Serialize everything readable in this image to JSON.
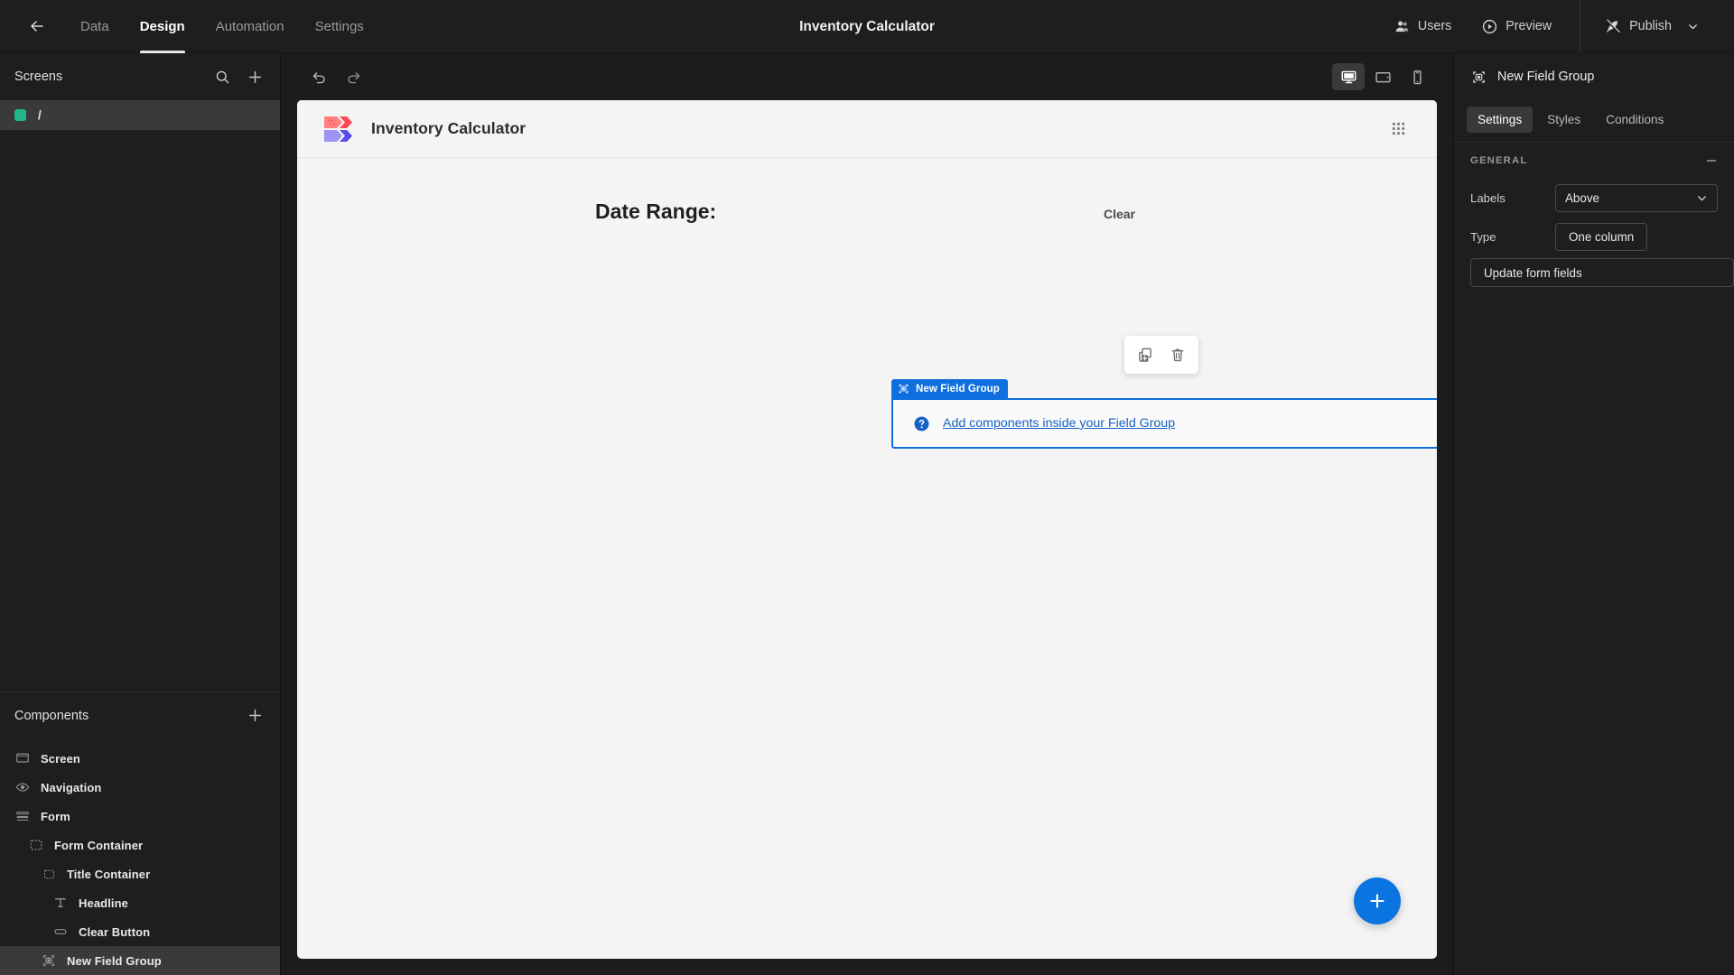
{
  "topbar": {
    "back_icon": "arrow-left-icon",
    "nav_tabs": [
      {
        "label": "Data",
        "active": false
      },
      {
        "label": "Design",
        "active": true
      },
      {
        "label": "Automation",
        "active": false
      },
      {
        "label": "Settings",
        "active": false
      }
    ],
    "title": "Inventory Calculator",
    "users_label": "Users",
    "preview_label": "Preview",
    "publish_label": "Publish"
  },
  "left_panel": {
    "screens": {
      "title": "Screens",
      "search_icon": "search-icon",
      "add_icon": "plus-icon",
      "items": [
        {
          "label": "/",
          "color": "#23b58a",
          "selected": true
        }
      ]
    },
    "components": {
      "title": "Components",
      "add_icon": "plus-icon",
      "tree": [
        {
          "label": "Screen",
          "icon": "screen-icon",
          "depth": 0,
          "selected": false
        },
        {
          "label": "Navigation",
          "icon": "eye-icon",
          "depth": 0,
          "selected": false
        },
        {
          "label": "Form",
          "icon": "form-icon",
          "depth": 0,
          "selected": false
        },
        {
          "label": "Form Container",
          "icon": "container-icon",
          "depth": 1,
          "selected": false
        },
        {
          "label": "Title Container",
          "icon": "container-icon",
          "depth": 2,
          "selected": false
        },
        {
          "label": "Headline",
          "icon": "text-icon",
          "depth": 3,
          "selected": false
        },
        {
          "label": "Clear Button",
          "icon": "button-icon",
          "depth": 3,
          "selected": false
        },
        {
          "label": "New Field Group",
          "icon": "field-group-icon",
          "depth": 2,
          "selected": true
        }
      ]
    }
  },
  "center": {
    "undo_icon": "undo-icon",
    "redo_icon": "redo-icon",
    "devices": [
      {
        "name": "desktop",
        "icon": "desktop-icon",
        "active": true
      },
      {
        "name": "tablet",
        "icon": "tablet-icon",
        "active": false
      },
      {
        "name": "mobile",
        "icon": "mobile-icon",
        "active": false
      }
    ],
    "app_nav": {
      "title": "Inventory Calculator",
      "logo_colors": [
        "#ff8080",
        "#ff4757",
        "#9d93f5",
        "#5b4ee8"
      ],
      "grid_icon": "grid-dots-icon"
    },
    "form": {
      "headline": "Date Range:",
      "clear_label": "Clear",
      "float_tools": [
        {
          "name": "duplicate",
          "icon": "duplicate-icon"
        },
        {
          "name": "delete",
          "icon": "trash-icon"
        }
      ],
      "selection": {
        "tab_label": "New Field Group",
        "tab_icon": "field-group-icon",
        "accent_color": "#0f6fde",
        "hint_icon": "help-circle-icon",
        "hint_text": "Add components inside your Field Group"
      }
    },
    "fab_icon": "plus-icon"
  },
  "right_panel": {
    "header_icon": "field-group-icon",
    "header_title": "New Field Group",
    "tabs": [
      {
        "label": "Settings",
        "active": true
      },
      {
        "label": "Styles",
        "active": false
      },
      {
        "label": "Conditions",
        "active": false
      }
    ],
    "section": {
      "title": "GENERAL",
      "collapse_icon": "minus-icon"
    },
    "props": [
      {
        "label": "Labels",
        "control": "select",
        "value": "Above",
        "chevron_icon": "chevron-down-icon"
      },
      {
        "label": "Type",
        "control": "button",
        "value": "One column"
      }
    ],
    "update_button": "Update form fields"
  }
}
